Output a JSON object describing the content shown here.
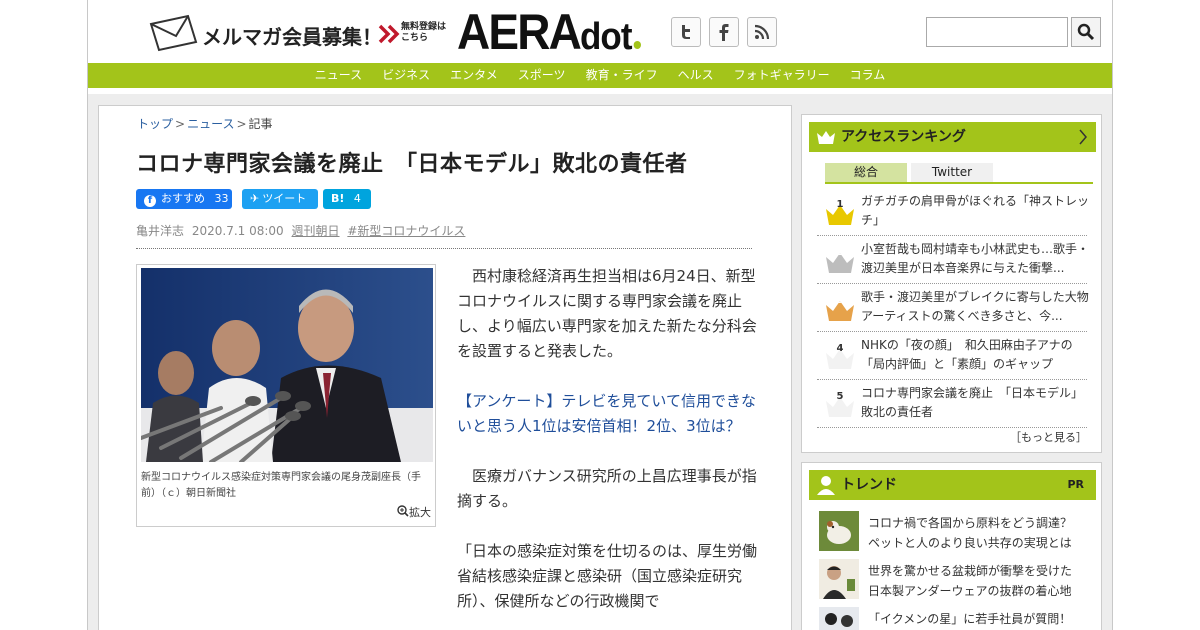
{
  "header": {
    "mailmag_label": "メルマガ会員募集！",
    "free_label_1": "無料登録は",
    "free_label_2": "こちら",
    "logo_main": "AERA",
    "logo_sub": "dot",
    "twitter_icon": "twitter-icon",
    "facebook_icon": "facebook-icon",
    "rss_icon": "rss-icon",
    "search_placeholder": ""
  },
  "nav": {
    "items": [
      "ニュース",
      "ビジネス",
      "エンタメ",
      "スポーツ",
      "教育・ライフ",
      "ヘルス",
      "フォトギャラリー",
      "コラム"
    ]
  },
  "article": {
    "breadcrumb": [
      "トップ",
      "ニュース",
      "記事"
    ],
    "title": "コロナ専門家会議を廃止　「日本モデル」敗北の責任者",
    "share": {
      "facebook_label": "おすすめ",
      "facebook_count": "33",
      "tweet_label": "ツイート",
      "hatena_label": "B!",
      "hatena_count": "4"
    },
    "author": "亀井洋志",
    "date": "2020.7.1 08:00",
    "magazine": "週刊朝日",
    "tag": "#新型コロナウイルス",
    "photo_caption": "新型コロナウイルス感染症対策専門家会議の尾身茂副座長（手前）（ｃ）朝日新聞社",
    "enlarge_label": "拡大",
    "paragraphs": [
      "　西村康稔経済再生担当相は6月24日、新型コロナウイルスに関する専門家会議を廃止し、より幅広い専門家を加えた新たな分科会を設置すると発表した。",
      "【アンケート】テレビを見ていて信用できないと思う人1位は安倍首相！2位、3位は？",
      "　医療ガバナンス研究所の上昌広理事長が指摘する。",
      "「日本の感染症対策を仕切るのは、厚生労働省結核感染症課と感染研（国立感染症研究所）、保健所などの行政機関で"
    ]
  },
  "ranking": {
    "title": "アクセスランキング",
    "tabs": [
      "総合",
      "Twitter"
    ],
    "items": [
      {
        "rank": "1",
        "text": "ガチガチの肩甲骨がほぐれる「神ストレッチ」"
      },
      {
        "rank": "2",
        "text": "小室哲哉も岡村靖幸も小林武史も…歌手・渡辺美里が日本音楽界に与えた衝撃..."
      },
      {
        "rank": "3",
        "text": "歌手・渡辺美里がブレイクに寄与した大物アーティストの驚くべき多さと、今..."
      },
      {
        "rank": "4",
        "text": "NHKの「夜の顔」　和久田麻由子アナの「局内評価」と「素顔」のギャップ"
      },
      {
        "rank": "5",
        "text": "コロナ専門家会議を廃止　「日本モデル」敗北の責任者"
      }
    ],
    "more_label": "［もっと見る］"
  },
  "trend": {
    "title": "トレンド",
    "pr_label": "PR",
    "items": [
      {
        "line1": "コロナ禍で各国から原料をどう調達？",
        "line2": "ペットと人のより良い共存の実現とは"
      },
      {
        "line1": "世界を驚かせる盆栽師が衝撃を受けた",
        "line2": "日本製アンダーウェアの抜群の着心地"
      },
      {
        "line1": "「イクメンの星」に若手社員が質問！",
        "line2": ""
      }
    ]
  },
  "colors": {
    "accent": "#a3c41a",
    "facebook": "#1877f2",
    "twitter": "#1da1f2",
    "hatena": "#00a4de",
    "link": "#1f4e9a"
  }
}
